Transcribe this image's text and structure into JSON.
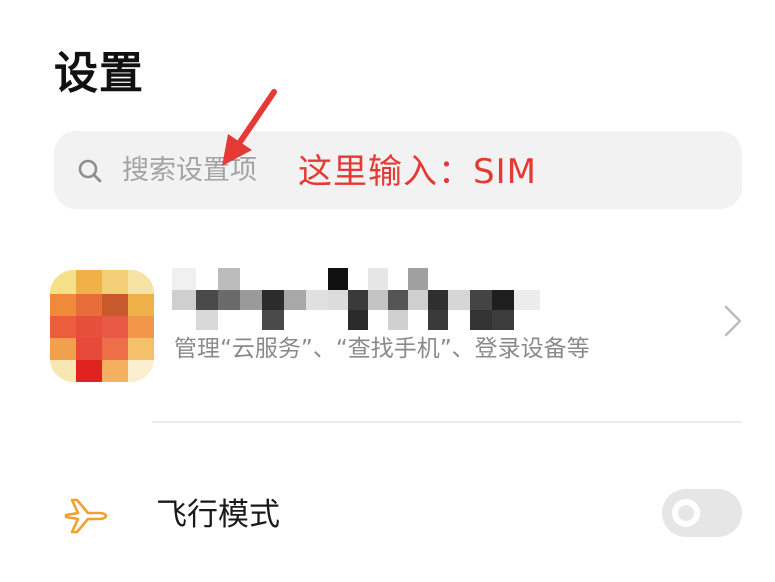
{
  "header": {
    "title": "设置"
  },
  "search": {
    "placeholder": "搜索设置项",
    "icon": "search-icon"
  },
  "annotation": {
    "text": "这里输入：SIM",
    "color": "#e53935"
  },
  "account": {
    "subtitle": "管理“云服务”、“查找手机”、登录设备等",
    "chevron_icon": "chevron-right-icon"
  },
  "settings": {
    "airplane_mode": {
      "label": "飞行模式",
      "icon": "airplane-icon",
      "icon_color": "#f0a030",
      "enabled": false
    }
  },
  "colors": {
    "background": "#ffffff",
    "search_bg": "#f2f2f2",
    "placeholder": "#a3a3a3",
    "subtitle": "#8a8a8a",
    "toggle_off": "#e6e6e6"
  }
}
